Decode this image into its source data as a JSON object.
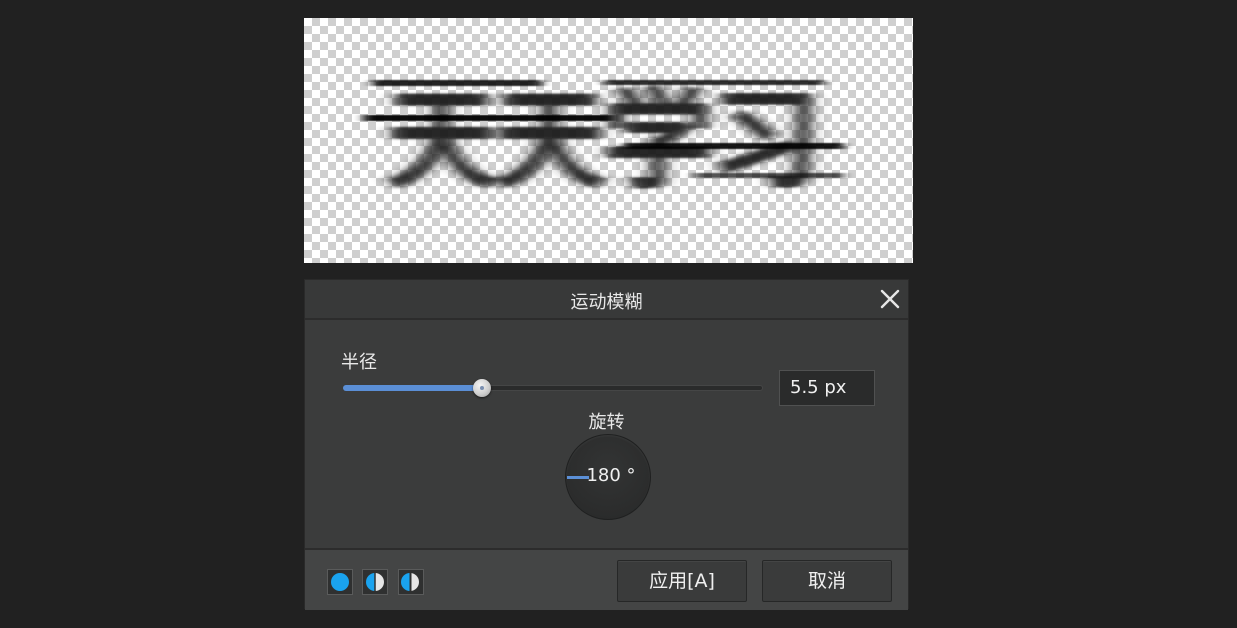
{
  "preview": {
    "text": "天天学习",
    "background": "transparency-checkerboard"
  },
  "dialog": {
    "title": "运动模糊",
    "close_icon": "close-icon",
    "radius": {
      "label": "半径",
      "value": "5.5 px",
      "slider_fraction": 0.33
    },
    "rotation": {
      "label": "旋转",
      "value": "180 °"
    },
    "footer": {
      "modes": [
        "full-circle-icon",
        "half-circle-split-icon",
        "half-circle-compare-icon"
      ],
      "apply_label": "应用[A]",
      "cancel_label": "取消"
    }
  },
  "colors": {
    "accent": "#5b8fd6",
    "mode_icon": "#1aa3ef",
    "background": "#212121",
    "panel": "#3b3c3c"
  }
}
